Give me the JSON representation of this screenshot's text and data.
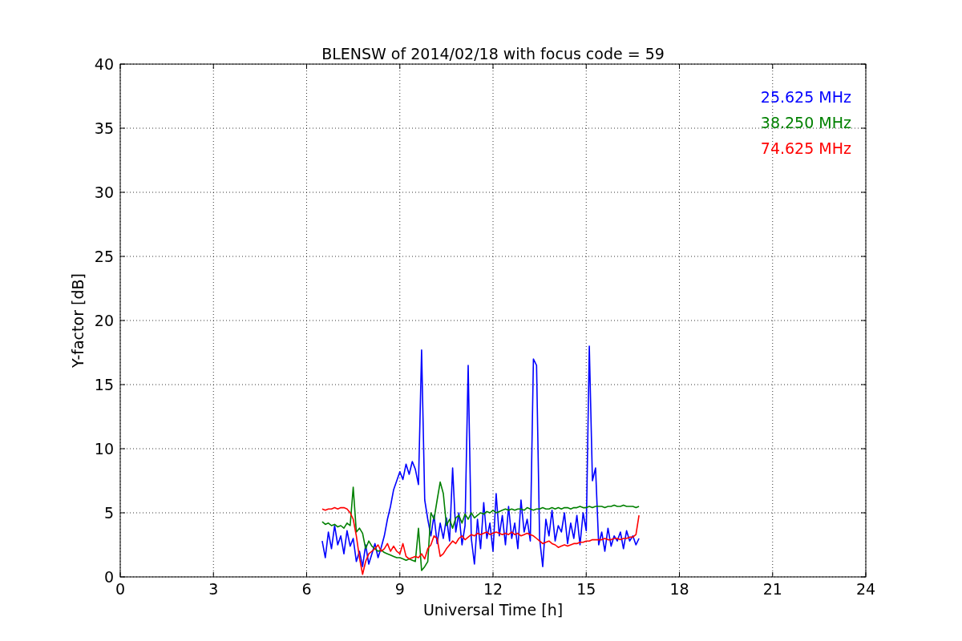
{
  "chart_data": {
    "type": "line",
    "title": "BLENSW of 2014/02/18 with focus code = 59",
    "xlabel": "Universal Time [h]",
    "ylabel": "Y-factor [dB]",
    "x": [
      6.5,
      6.6,
      6.7,
      6.8,
      6.9,
      7.0,
      7.1,
      7.2,
      7.3,
      7.4,
      7.5,
      7.6,
      7.7,
      7.8,
      7.9,
      8.0,
      8.1,
      8.2,
      8.3,
      8.4,
      8.5,
      8.6,
      8.7,
      8.8,
      8.9,
      9.0,
      9.1,
      9.2,
      9.3,
      9.4,
      9.5,
      9.6,
      9.7,
      9.8,
      9.9,
      10.0,
      10.1,
      10.2,
      10.3,
      10.4,
      10.5,
      10.6,
      10.7,
      10.8,
      10.9,
      11.0,
      11.1,
      11.2,
      11.3,
      11.4,
      11.5,
      11.6,
      11.7,
      11.8,
      11.9,
      12.0,
      12.1,
      12.2,
      12.3,
      12.4,
      12.5,
      12.6,
      12.7,
      12.8,
      12.9,
      13.0,
      13.1,
      13.2,
      13.3,
      13.4,
      13.5,
      13.6,
      13.7,
      13.8,
      13.9,
      14.0,
      14.1,
      14.2,
      14.3,
      14.4,
      14.5,
      14.6,
      14.7,
      14.8,
      14.9,
      15.0,
      15.1,
      15.2,
      15.3,
      15.4,
      15.5,
      15.6,
      15.7,
      15.8,
      15.9,
      16.0,
      16.1,
      16.2,
      16.3,
      16.4,
      16.5,
      16.6,
      16.7
    ],
    "series": [
      {
        "name": "25.625 MHz",
        "color": "#0000ff",
        "values": [
          2.8,
          1.5,
          3.5,
          2.2,
          4.0,
          2.5,
          3.2,
          1.8,
          3.6,
          2.4,
          3.0,
          1.2,
          2.0,
          0.8,
          2.5,
          1.0,
          1.8,
          2.6,
          1.5,
          2.3,
          3.2,
          4.5,
          5.5,
          6.8,
          7.5,
          8.2,
          7.6,
          8.8,
          8.0,
          9.0,
          8.4,
          7.2,
          17.7,
          6.0,
          4.5,
          3.2,
          4.8,
          2.6,
          4.2,
          3.0,
          4.6,
          2.8,
          8.5,
          3.5,
          5.0,
          2.5,
          4.0,
          16.5,
          3.0,
          1.0,
          4.5,
          2.2,
          5.8,
          3.0,
          4.2,
          2.0,
          6.5,
          3.2,
          4.8,
          2.5,
          5.5,
          3.0,
          4.2,
          2.2,
          6.0,
          3.5,
          4.5,
          2.8,
          17.0,
          16.5,
          3.0,
          0.8,
          4.5,
          3.2,
          5.2,
          2.8,
          4.0,
          3.5,
          5.0,
          2.6,
          4.2,
          3.0,
          4.8,
          2.5,
          5.0,
          3.6,
          18.0,
          7.5,
          8.5,
          2.5,
          3.5,
          2.0,
          3.8,
          2.4,
          3.2,
          2.8,
          3.5,
          2.2,
          3.6,
          2.8,
          3.2,
          2.5,
          3.0
        ]
      },
      {
        "name": "38.250 MHz",
        "color": "#008000",
        "values": [
          4.3,
          4.1,
          4.2,
          4.0,
          4.1,
          3.9,
          4.0,
          3.8,
          4.2,
          4.0,
          7.0,
          3.5,
          3.8,
          3.4,
          2.2,
          2.8,
          2.4,
          2.2,
          2.0,
          2.1,
          1.9,
          1.8,
          1.7,
          1.6,
          1.5,
          1.5,
          1.4,
          1.3,
          1.4,
          1.3,
          1.2,
          3.8,
          0.5,
          0.8,
          1.2,
          5.0,
          4.5,
          6.0,
          7.4,
          6.5,
          4.0,
          4.5,
          3.8,
          4.6,
          4.8,
          4.2,
          4.9,
          4.5,
          5.0,
          4.6,
          4.8,
          5.0,
          4.9,
          5.1,
          5.0,
          5.2,
          5.0,
          5.1,
          5.2,
          5.3,
          5.2,
          5.3,
          5.2,
          5.3,
          5.3,
          5.2,
          5.4,
          5.3,
          5.2,
          5.3,
          5.3,
          5.4,
          5.3,
          5.3,
          5.4,
          5.3,
          5.4,
          5.3,
          5.4,
          5.4,
          5.3,
          5.4,
          5.4,
          5.5,
          5.4,
          5.4,
          5.5,
          5.4,
          5.5,
          5.5,
          5.5,
          5.4,
          5.5,
          5.5,
          5.6,
          5.5,
          5.5,
          5.6,
          5.5,
          5.5,
          5.5,
          5.4,
          5.5
        ]
      },
      {
        "name": "74.625 MHz",
        "color": "#ff0000",
        "values": [
          5.3,
          5.2,
          5.3,
          5.3,
          5.4,
          5.3,
          5.4,
          5.4,
          5.3,
          5.0,
          4.5,
          3.2,
          1.5,
          0.2,
          1.2,
          1.8,
          2.0,
          2.2,
          2.5,
          2.0,
          2.2,
          2.6,
          2.0,
          2.4,
          2.0,
          1.8,
          2.6,
          1.6,
          1.4,
          1.5,
          1.6,
          1.5,
          1.8,
          1.4,
          2.2,
          2.5,
          3.2,
          3.0,
          1.6,
          1.8,
          2.2,
          2.5,
          2.8,
          2.6,
          3.0,
          3.2,
          2.9,
          3.1,
          3.3,
          3.2,
          3.4,
          3.3,
          3.4,
          3.5,
          3.3,
          3.4,
          3.5,
          3.4,
          3.3,
          3.4,
          3.3,
          3.5,
          3.3,
          3.4,
          3.2,
          3.3,
          3.4,
          3.3,
          3.2,
          3.0,
          2.8,
          2.6,
          2.7,
          2.8,
          2.6,
          2.5,
          2.3,
          2.4,
          2.5,
          2.4,
          2.5,
          2.6,
          2.6,
          2.7,
          2.7,
          2.8,
          2.8,
          2.9,
          2.9,
          2.9,
          2.9,
          3.0,
          2.9,
          2.9,
          3.0,
          3.0,
          2.9,
          3.0,
          3.0,
          3.1,
          3.1,
          3.3,
          4.8
        ]
      }
    ],
    "xlim": [
      0,
      24
    ],
    "ylim": [
      0,
      40
    ],
    "xticks": [
      0,
      3,
      6,
      9,
      12,
      15,
      18,
      21,
      24
    ],
    "yticks": [
      0,
      5,
      10,
      15,
      20,
      25,
      30,
      35,
      40
    ],
    "grid": true
  }
}
